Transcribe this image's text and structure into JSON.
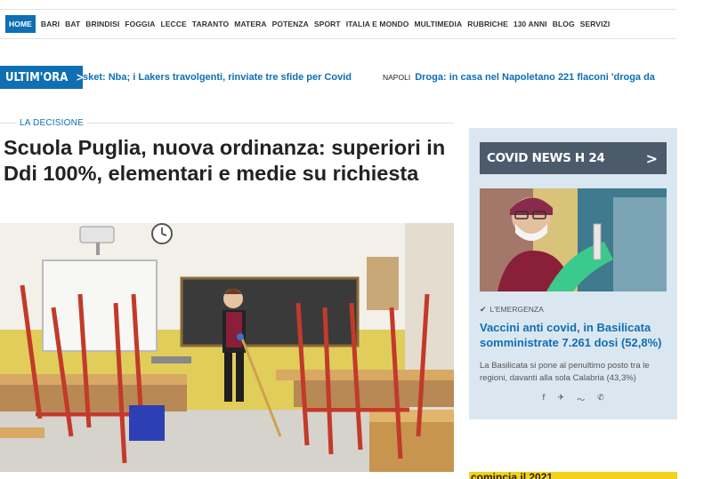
{
  "nav": {
    "items": [
      "HOME",
      "BARI",
      "BAT",
      "BRINDISI",
      "FOGGIA",
      "LECCE",
      "TARANTO",
      "MATERA",
      "POTENZA",
      "SPORT",
      "ITALIA E MONDO",
      "MULTIMEDIA",
      "RUBRICHE",
      "130 ANNI",
      "BLOG",
      "SERVIZI"
    ]
  },
  "ticker": {
    "label": "ULTIM'ORA",
    "arrow": ">",
    "item1": "sket: Nba; i Lakers travolgenti, rinviate tre sfide per Covid",
    "item2_city": "NAPOLI",
    "item2": "Droga: in casa nel Napoletano 221 flaconi 'droga da"
  },
  "article": {
    "kicker": "LA DECISIONE",
    "title": "Scuola Puglia, nuova ordinanza: superiori in Ddi 100%, elementari e medie su richiesta"
  },
  "sidebar": {
    "header": "COVID NEWS H 24",
    "chevron": ">",
    "kicker": "L'EMERGENZA",
    "title": "Vaccini anti covid, in Basilicata somministrate 7.261 dosi (52,8%)",
    "desc": "La Basilicata si pone al penultimo posto tra le regioni, davanti alla sola Calabria (43,3%)",
    "social": [
      "f",
      "✈",
      "〜",
      "✆"
    ]
  },
  "ad": {
    "text": "comincia il 2021"
  },
  "colors": {
    "accent": "#0e6fb3",
    "sidebar_bg": "#dbe7f0",
    "sidebar_header": "#4c5b6a"
  }
}
